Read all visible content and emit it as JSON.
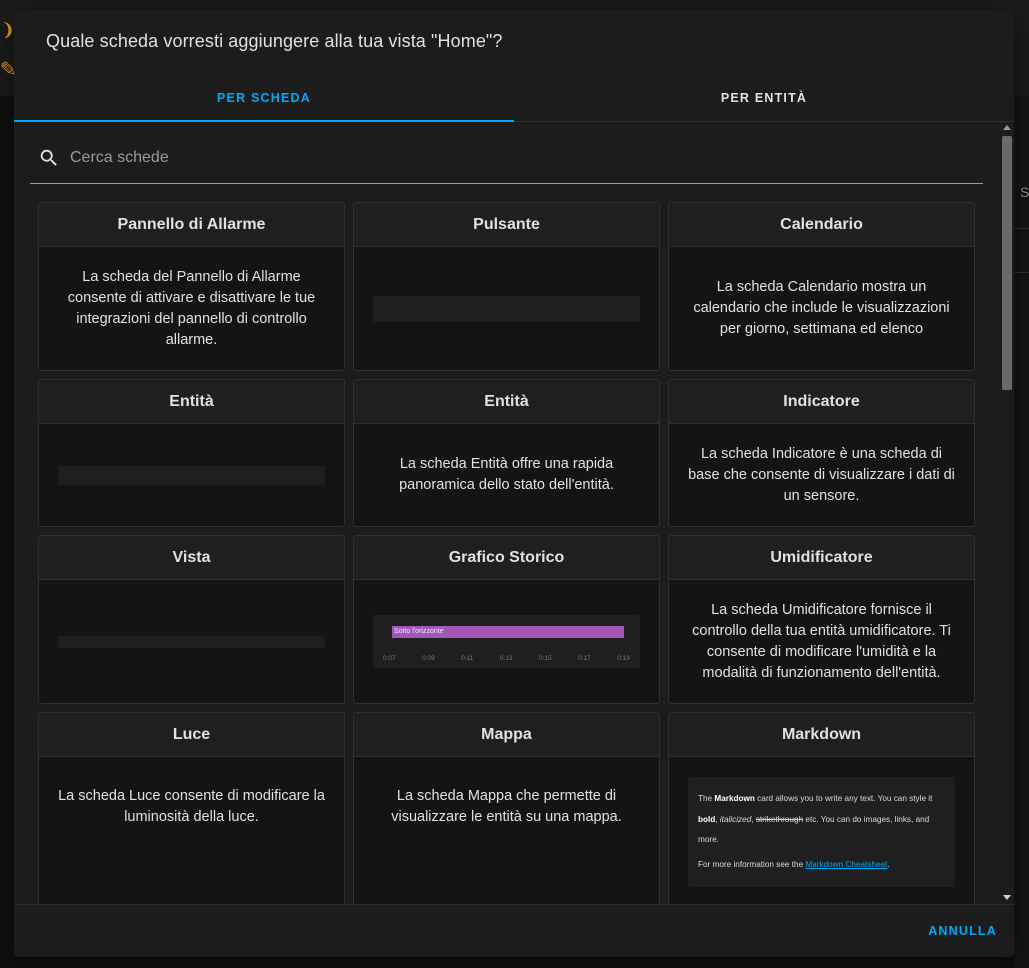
{
  "dialog": {
    "title": "Quale scheda vorresti aggiungere alla tua vista \"Home\"?",
    "tabs": [
      {
        "label": "PER SCHEDA",
        "active": true
      },
      {
        "label": "PER ENTITÀ",
        "active": false
      }
    ],
    "search": {
      "placeholder": "Cerca schede",
      "value": ""
    },
    "cancel_label": "ANNULLA"
  },
  "background": {
    "right_letter": "S"
  },
  "cards": [
    {
      "title": "Pannello di Allarme",
      "description": "La scheda del Pannello di Allarme consente di attivare e disattivare le tue integrazioni del pannello di controllo allarme."
    },
    {
      "title": "Pulsante",
      "description": ""
    },
    {
      "title": "Calendario",
      "description": "La scheda Calendario mostra un calendario che include le visualizzazioni per giorno, settimana ed elenco"
    },
    {
      "title": "Entità",
      "description": ""
    },
    {
      "title": "Entità",
      "description": "La scheda Entità offre una rapida panoramica dello stato dell'entità."
    },
    {
      "title": "Indicatore",
      "description": "La scheda Indicatore è una scheda di base che consente di visualizzare i dati di un sensore."
    },
    {
      "title": "Vista",
      "description": ""
    },
    {
      "title": "Grafico Storico",
      "description": ""
    },
    {
      "title": "Umidificatore",
      "description": "La scheda Umidificatore fornisce il controllo della tua entità umidificatore. Ti consente di modificare l'umidità e la modalità di funzionamento dell'entità."
    },
    {
      "title": "Luce",
      "description": "La scheda Luce consente di modificare la luminosità della luce."
    },
    {
      "title": "Mappa",
      "description": "La scheda Mappa che permette di visualizzare le entità su una mappa."
    },
    {
      "title": "Markdown",
      "description": ""
    }
  ],
  "history_preview": {
    "bar_label": "Sotto l'orizzonte",
    "bar_color": "#a256b8",
    "ticks": [
      "0:07",
      "0:09",
      "0:11",
      "0:13",
      "0:15",
      "0:17",
      "0:19"
    ]
  },
  "markdown_preview": {
    "p1_a": "The ",
    "p1_bold": "Markdown",
    "p1_b": " card allows you to write any text. You can style it ",
    "p1_bold2": "bold",
    "p1_c": ", ",
    "p1_italic": "italicized",
    "p1_d": ", ",
    "p1_strike": "strikethrough",
    "p1_e": " etc. You can do images, links, and more.",
    "p2_a": "For more information see the ",
    "p2_link": "Markdown Cheatsheet",
    "p2_b": "."
  },
  "colors": {
    "accent": "#03a9f4",
    "dialog_bg": "#1c1c1c",
    "card_bg": "#141414"
  }
}
